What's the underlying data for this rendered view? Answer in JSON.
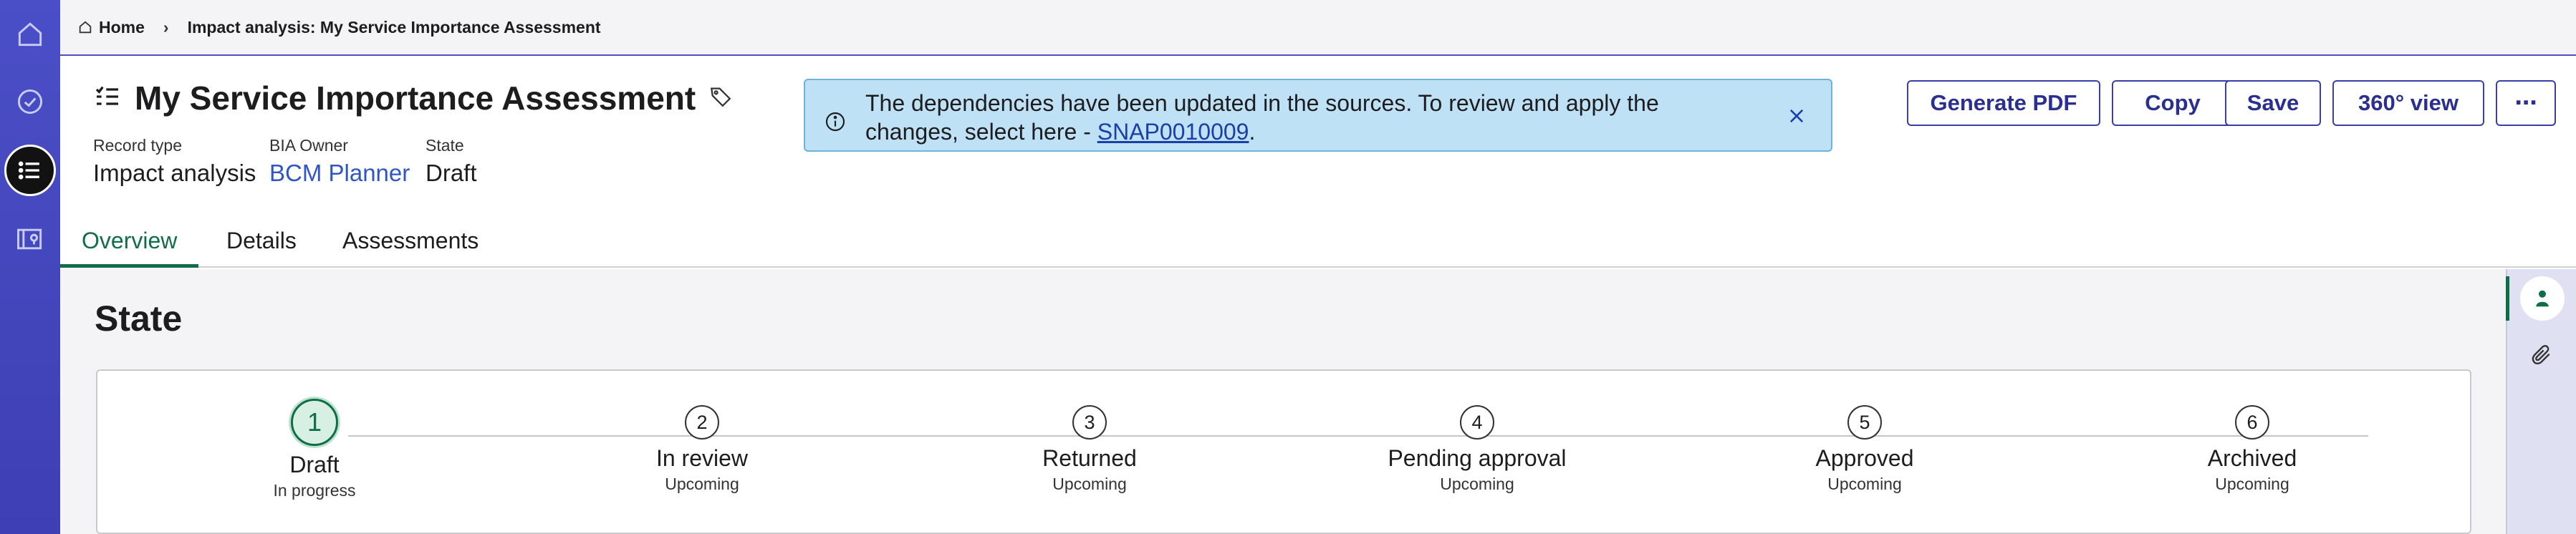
{
  "breadcrumb": {
    "home": "Home",
    "current": "Impact analysis: My Service Importance Assessment"
  },
  "header": {
    "title": "My Service Importance Assessment",
    "record_type_label": "Record type",
    "record_type_value": "Impact analysis",
    "owner_label": "BIA Owner",
    "owner_value": "BCM Planner",
    "state_label": "State",
    "state_value": "Draft"
  },
  "notice": {
    "text": "The dependencies have been updated in the sources. To review and apply the changes, select here - ",
    "link": "SNAP0010009",
    "suffix": "."
  },
  "actions": {
    "generate_pdf": "Generate PDF",
    "copy": "Copy",
    "save": "Save",
    "view360": "360° view",
    "more": "⋯"
  },
  "tabs": [
    "Overview",
    "Details",
    "Assessments"
  ],
  "state_section": {
    "heading": "State",
    "steps": [
      {
        "num": "1",
        "name": "Draft",
        "status": "In progress"
      },
      {
        "num": "2",
        "name": "In review",
        "status": "Upcoming"
      },
      {
        "num": "3",
        "name": "Returned",
        "status": "Upcoming"
      },
      {
        "num": "4",
        "name": "Pending approval",
        "status": "Upcoming"
      },
      {
        "num": "5",
        "name": "Approved",
        "status": "Upcoming"
      },
      {
        "num": "6",
        "name": "Archived",
        "status": "Upcoming"
      }
    ]
  },
  "colors": {
    "rail": "#4b4fc7",
    "accent_green": "#0f6e46",
    "notice_bg": "#bfe1f5",
    "button_text": "#2b2f8f"
  },
  "icons": {
    "rail": [
      "home-icon",
      "check-circle-icon",
      "list-icon",
      "map-book-icon"
    ],
    "side": [
      "person-icon",
      "paperclip-icon"
    ]
  }
}
